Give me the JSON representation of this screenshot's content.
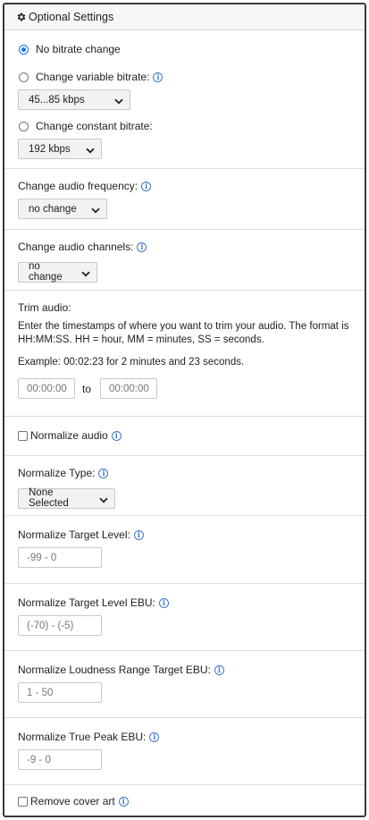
{
  "header": {
    "title": "Optional Settings",
    "icon": "gear-icon"
  },
  "bitrate": {
    "options": [
      {
        "label": "No bitrate change",
        "checked": true
      },
      {
        "label": "Change variable bitrate:",
        "checked": false,
        "select_value": "45...85 kbps"
      },
      {
        "label": "Change constant bitrate:",
        "checked": false,
        "select_value": "192 kbps"
      }
    ]
  },
  "frequency": {
    "label": "Change audio frequency:",
    "select_value": "no change"
  },
  "channels": {
    "label": "Change audio channels:",
    "select_value": "no change"
  },
  "trim": {
    "label": "Trim audio:",
    "description": "Enter the timestamps of where you want to trim your audio. The format is HH:MM:SS. HH = hour, MM = minutes, SS = seconds.",
    "example": "Example: 00:02:23 for 2 minutes and 23 seconds.",
    "from_placeholder": "00:00:00",
    "to_label": "to",
    "to_placeholder": "00:00:00"
  },
  "normalize_audio": {
    "label": "Normalize audio",
    "checked": false
  },
  "normalize_type": {
    "label": "Normalize Type:",
    "select_value": "None Selected"
  },
  "target_level": {
    "label": "Normalize Target Level:",
    "placeholder": "-99 - 0"
  },
  "target_level_ebu": {
    "label": "Normalize Target Level EBU:",
    "placeholder": "(-70) - (-5)"
  },
  "loudness_range": {
    "label": "Normalize Loudness Range Target EBU:",
    "placeholder": "1 - 50"
  },
  "true_peak": {
    "label": "Normalize True Peak EBU:",
    "placeholder": "-9 - 0"
  },
  "remove_cover": {
    "label": "Remove cover art",
    "checked": false
  },
  "colors": {
    "accent": "#1a73e8",
    "info": "#3b78c9",
    "border": "#3a3a3a"
  }
}
